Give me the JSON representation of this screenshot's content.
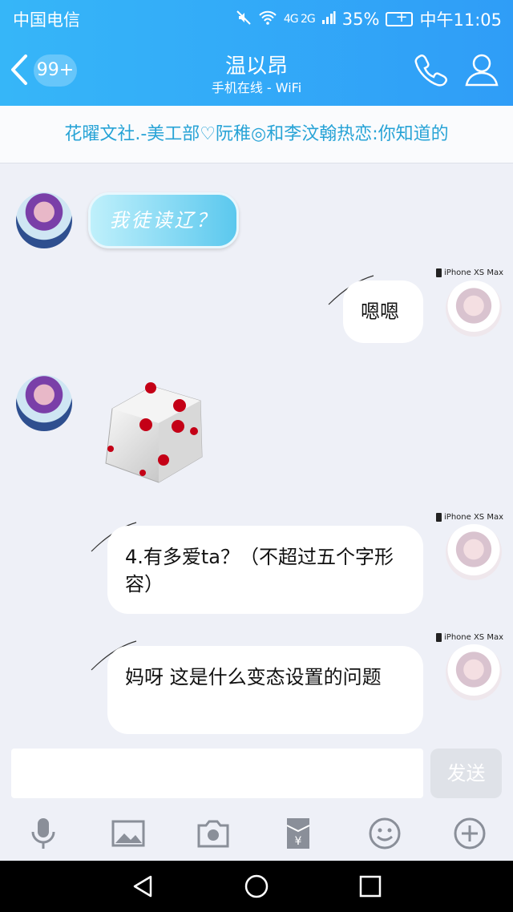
{
  "status_bar": {
    "carrier": "中国电信",
    "network": "4G 2G",
    "battery": "35%",
    "time": "中午11:05"
  },
  "header": {
    "unread_badge": "99+",
    "contact_name": "温以昂",
    "presence": "手机在线 - WiFi",
    "call_icon": "phone-icon",
    "profile_icon": "person-icon",
    "back_icon": "chevron-left-icon"
  },
  "banner": {
    "text": "花曜文社.-美工部♡阮稚◎和李汶翰热恋:你知道的"
  },
  "messages": [
    {
      "side": "left",
      "text": "我徒读辽？"
    },
    {
      "side": "right",
      "device": "iPhone XS Max",
      "text": "嗯嗯"
    },
    {
      "side": "left",
      "type": "dice"
    },
    {
      "side": "right",
      "device": "iPhone XS Max",
      "text": "4.有多爱ta？（不超过五个字形容）"
    },
    {
      "side": "right",
      "device": "iPhone XS Max",
      "text": "妈呀 这是什么变态设置的问题"
    }
  ],
  "composer": {
    "send_label": "发送"
  },
  "toolbar": [
    "mic-icon",
    "image-icon",
    "camera-icon",
    "red-envelope-icon",
    "emoji-icon",
    "plus-icon"
  ],
  "android_nav": [
    "back-triangle-icon",
    "home-circle-icon",
    "recents-square-icon"
  ]
}
